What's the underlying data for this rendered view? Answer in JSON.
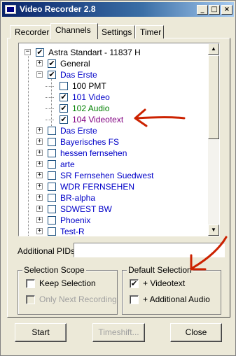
{
  "window": {
    "title": "Video Recorder 2.8",
    "controls": {
      "minimize": "_",
      "maximize": "□",
      "close": "×"
    }
  },
  "tabs": [
    {
      "label": "Recorder",
      "active": false
    },
    {
      "label": "Channels",
      "active": true
    },
    {
      "label": "Settings",
      "active": false
    },
    {
      "label": "Timer",
      "active": false
    }
  ],
  "tree": {
    "rows": [
      {
        "label": "Astra Standart - 11837 H",
        "color": "#000000",
        "expander": "−",
        "checked": true
      },
      {
        "label": "General",
        "color": "#000000",
        "expander": "+",
        "checked": true
      },
      {
        "label": "Das Erste",
        "color": "#0000c8",
        "expander": "−",
        "checked": true
      },
      {
        "label": "100  PMT",
        "color": "#000000",
        "expander": "",
        "checked": false
      },
      {
        "label": "101  Video",
        "color": "#0000c8",
        "expander": "",
        "checked": true
      },
      {
        "label": "102  Audio",
        "color": "#008000",
        "expander": "",
        "checked": true
      },
      {
        "label": "104  Videotext",
        "color": "#800080",
        "expander": "",
        "checked": true
      },
      {
        "label": "Das Erste",
        "color": "#0000c8",
        "expander": "+",
        "checked": false
      },
      {
        "label": "Bayerisches FS",
        "color": "#0000c8",
        "expander": "+",
        "checked": false
      },
      {
        "label": "hessen fernsehen",
        "color": "#0000c8",
        "expander": "+",
        "checked": false
      },
      {
        "label": "arte",
        "color": "#0000c8",
        "expander": "+",
        "checked": false
      },
      {
        "label": "SR Fernsehen Suedwest",
        "color": "#0000c8",
        "expander": "+",
        "checked": false
      },
      {
        "label": "WDR FERNSEHEN",
        "color": "#0000c8",
        "expander": "+",
        "checked": false
      },
      {
        "label": "BR-alpha",
        "color": "#0000c8",
        "expander": "+",
        "checked": false
      },
      {
        "label": "SDWEST BW",
        "color": "#0000c8",
        "expander": "+",
        "checked": false
      },
      {
        "label": "Phoenix",
        "color": "#0000c8",
        "expander": "+",
        "checked": false
      },
      {
        "label": "Test-R",
        "color": "#0000c8",
        "expander": "+",
        "checked": false
      }
    ]
  },
  "additional_pids": {
    "label": "Additional PIDs:",
    "value": ""
  },
  "selection_scope": {
    "title": "Selection Scope",
    "keep_selection": {
      "label": "Keep Selection",
      "checked": false
    },
    "only_next": {
      "label": "Only Next Recording",
      "checked": false,
      "enabled": false
    }
  },
  "default_selection": {
    "title": "Default Selection",
    "videotext": {
      "label": "+ Videotext",
      "checked": true
    },
    "additional_audio": {
      "label": "+ Additional Audio",
      "checked": false
    }
  },
  "buttons": {
    "start": "Start",
    "timeshift": "Timeshift...",
    "close": "Close"
  },
  "check_glyph": "✔",
  "colors": {
    "annotation_arrow": "#cc2200",
    "title_bar": "#0a246a"
  }
}
